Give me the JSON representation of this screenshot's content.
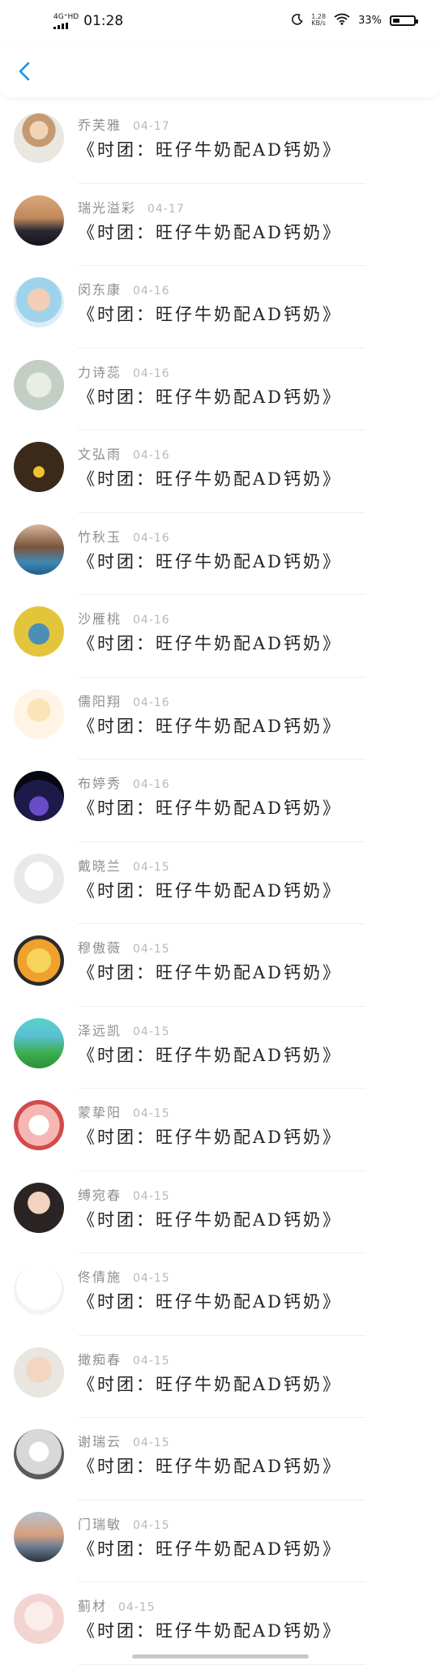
{
  "status_bar": {
    "network_type": "4G⁺HD",
    "time": "01:28",
    "speed_value": "1.28",
    "speed_unit": "KB/s",
    "battery_percent": "33%",
    "battery_level": 0.33
  },
  "nav": {
    "back_icon": "chevron-left-icon",
    "accent_color": "#1e90e6"
  },
  "messages": [
    {
      "name": "乔芙雅",
      "date": "04-17",
      "content": "《时团：旺仔牛奶配AD钙奶》"
    },
    {
      "name": "瑞光溢彩",
      "date": "04-17",
      "content": "《时团：旺仔牛奶配AD钙奶》"
    },
    {
      "name": "闵东康",
      "date": "04-16",
      "content": "《时团：旺仔牛奶配AD钙奶》"
    },
    {
      "name": "力诗蕊",
      "date": "04-16",
      "content": "《时团：旺仔牛奶配AD钙奶》"
    },
    {
      "name": "文弘雨",
      "date": "04-16",
      "content": "《时团：旺仔牛奶配AD钙奶》"
    },
    {
      "name": "竹秋玉",
      "date": "04-16",
      "content": "《时团：旺仔牛奶配AD钙奶》"
    },
    {
      "name": "沙雁桃",
      "date": "04-16",
      "content": "《时团：旺仔牛奶配AD钙奶》"
    },
    {
      "name": "儒阳翔",
      "date": "04-16",
      "content": "《时团：旺仔牛奶配AD钙奶》"
    },
    {
      "name": "布婷秀",
      "date": "04-16",
      "content": "《时团：旺仔牛奶配AD钙奶》"
    },
    {
      "name": "戴晓兰",
      "date": "04-15",
      "content": "《时团：旺仔牛奶配AD钙奶》"
    },
    {
      "name": "穆傲薇",
      "date": "04-15",
      "content": "《时团：旺仔牛奶配AD钙奶》"
    },
    {
      "name": "泽远凯",
      "date": "04-15",
      "content": "《时团：旺仔牛奶配AD钙奶》"
    },
    {
      "name": "蒙挚阳",
      "date": "04-15",
      "content": "《时团：旺仔牛奶配AD钙奶》"
    },
    {
      "name": "缚宛春",
      "date": "04-15",
      "content": "《时团：旺仔牛奶配AD钙奶》"
    },
    {
      "name": "佟倩施",
      "date": "04-15",
      "content": "《时团：旺仔牛奶配AD钙奶》"
    },
    {
      "name": "撖痴春",
      "date": "04-15",
      "content": "《时团：旺仔牛奶配AD钙奶》"
    },
    {
      "name": "谢瑞云",
      "date": "04-15",
      "content": "《时团：旺仔牛奶配AD钙奶》"
    },
    {
      "name": "门瑞敏",
      "date": "04-15",
      "content": "《时团：旺仔牛奶配AD钙奶》"
    },
    {
      "name": "蓟材",
      "date": "04-15",
      "content": "《时团：旺仔牛奶配AD钙奶》"
    }
  ]
}
